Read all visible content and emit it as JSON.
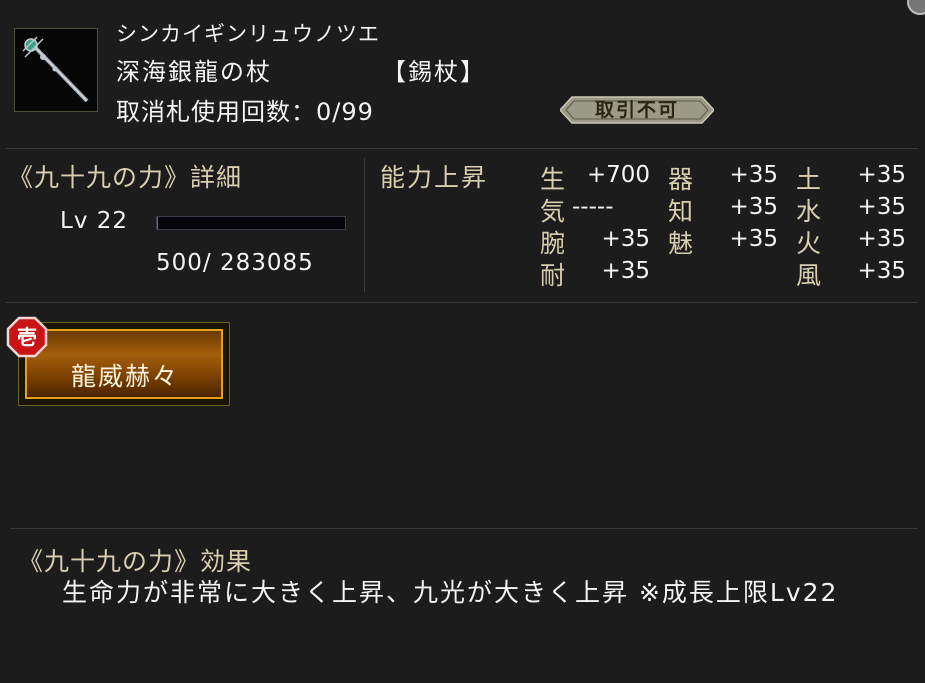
{
  "item": {
    "reading": "シンカイギンリュウノツエ",
    "name": "深海銀龍の杖",
    "category": "【錫杖】",
    "uses_label": "取消札使用回数：0/99",
    "trade_badge": "取引不可",
    "icon": "staff-icon"
  },
  "detail": {
    "title": "《九十九の力》詳細",
    "level_text": "Lv 22",
    "exp_text": "500/   283085",
    "exp_fraction": 0.0018
  },
  "abilities": {
    "title": "能力上昇",
    "stats": [
      {
        "key": "生",
        "value": "+700"
      },
      {
        "key": "器",
        "value": "+35"
      },
      {
        "key": "土",
        "value": "+35"
      },
      {
        "key": "気",
        "value": "-----"
      },
      {
        "key": "知",
        "value": "+35"
      },
      {
        "key": "水",
        "value": "+35"
      },
      {
        "key": "腕",
        "value": "+35"
      },
      {
        "key": "魅",
        "value": "+35"
      },
      {
        "key": "火",
        "value": "+35"
      },
      {
        "key": "耐",
        "value": "+35"
      },
      {
        "key": "風",
        "value": "+35"
      }
    ]
  },
  "skill": {
    "rank_badge": "壱",
    "name": "龍威赫々"
  },
  "effect": {
    "title": "《九十九の力》効果",
    "body": "生命力が非常に大きく上昇、九光が大きく上昇 ※成長上限Lv22"
  },
  "colors": {
    "background": "#1c1c1c",
    "label_tan": "#d8ceb0",
    "skill_gold": "#e0a020",
    "rank_red": "#c81414"
  }
}
